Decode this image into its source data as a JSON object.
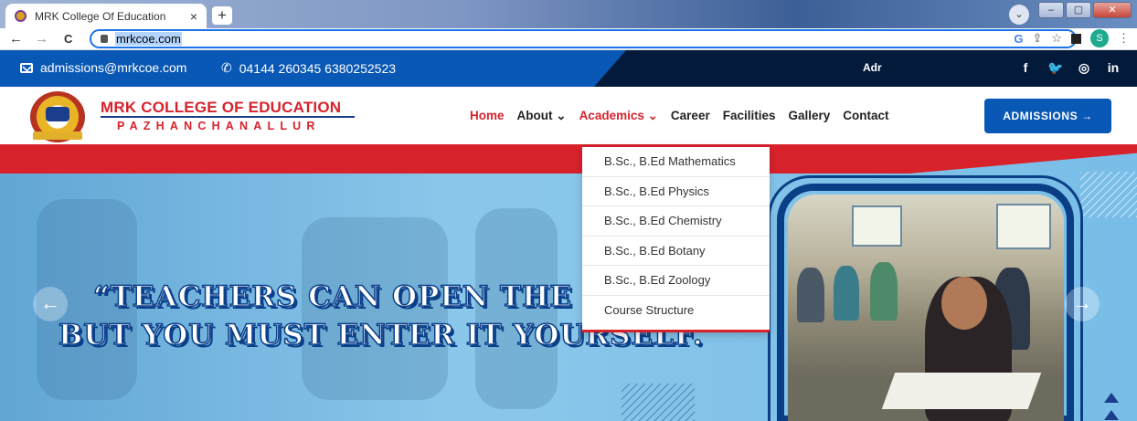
{
  "browser": {
    "tab_title": "MRK College Of Education",
    "tab_close": "×",
    "new_tab": "+",
    "url": "mrkcoe.com",
    "back": "←",
    "forward": "→",
    "reload": "C",
    "profile_initial": "S",
    "google": "G",
    "share": "⇪",
    "star": "☆",
    "menu": "⋮",
    "chevron": "⌄",
    "win_min": "–",
    "win_max": "▢",
    "win_close": "✕"
  },
  "topbar": {
    "email": "admissions@mrkcoe.com",
    "phone": "04144 260345  6380252523",
    "address_label": "Adr",
    "social": {
      "facebook": "f",
      "twitter": "🐦",
      "instagram": "◎",
      "linkedin": "in"
    }
  },
  "brand": {
    "title": "MRK COLLEGE OF EDUCATION",
    "subtitle": "PAZHANCHANALLUR"
  },
  "nav": {
    "items": [
      {
        "label": "Home",
        "active": true
      },
      {
        "label": "About ⌄",
        "active": false
      },
      {
        "label": "Academics ⌄",
        "active": true
      },
      {
        "label": "Career",
        "active": false
      },
      {
        "label": "Facilities",
        "active": false
      },
      {
        "label": "Gallery",
        "active": false
      },
      {
        "label": "Contact",
        "active": false
      }
    ],
    "cta": "ADMISSIONS →"
  },
  "academics_dropdown": [
    "B.Sc., B.Ed Mathematics",
    "B.Sc., B.Ed Physics",
    "B.Sc., B.Ed Chemistry",
    "B.Sc., B.Ed Botany",
    "B.Sc., B.Ed Zoology",
    "Course Structure"
  ],
  "hero": {
    "quote_line1": "“TEACHERS CAN OPEN THE",
    "quote_line2": "BUT YOU MUST ENTER IT YOURSELF.",
    "prev": "←",
    "next": "→"
  },
  "colors": {
    "primary_blue": "#0a58b5",
    "brand_red": "#d7222c",
    "dark_navy": "#041a3a"
  }
}
